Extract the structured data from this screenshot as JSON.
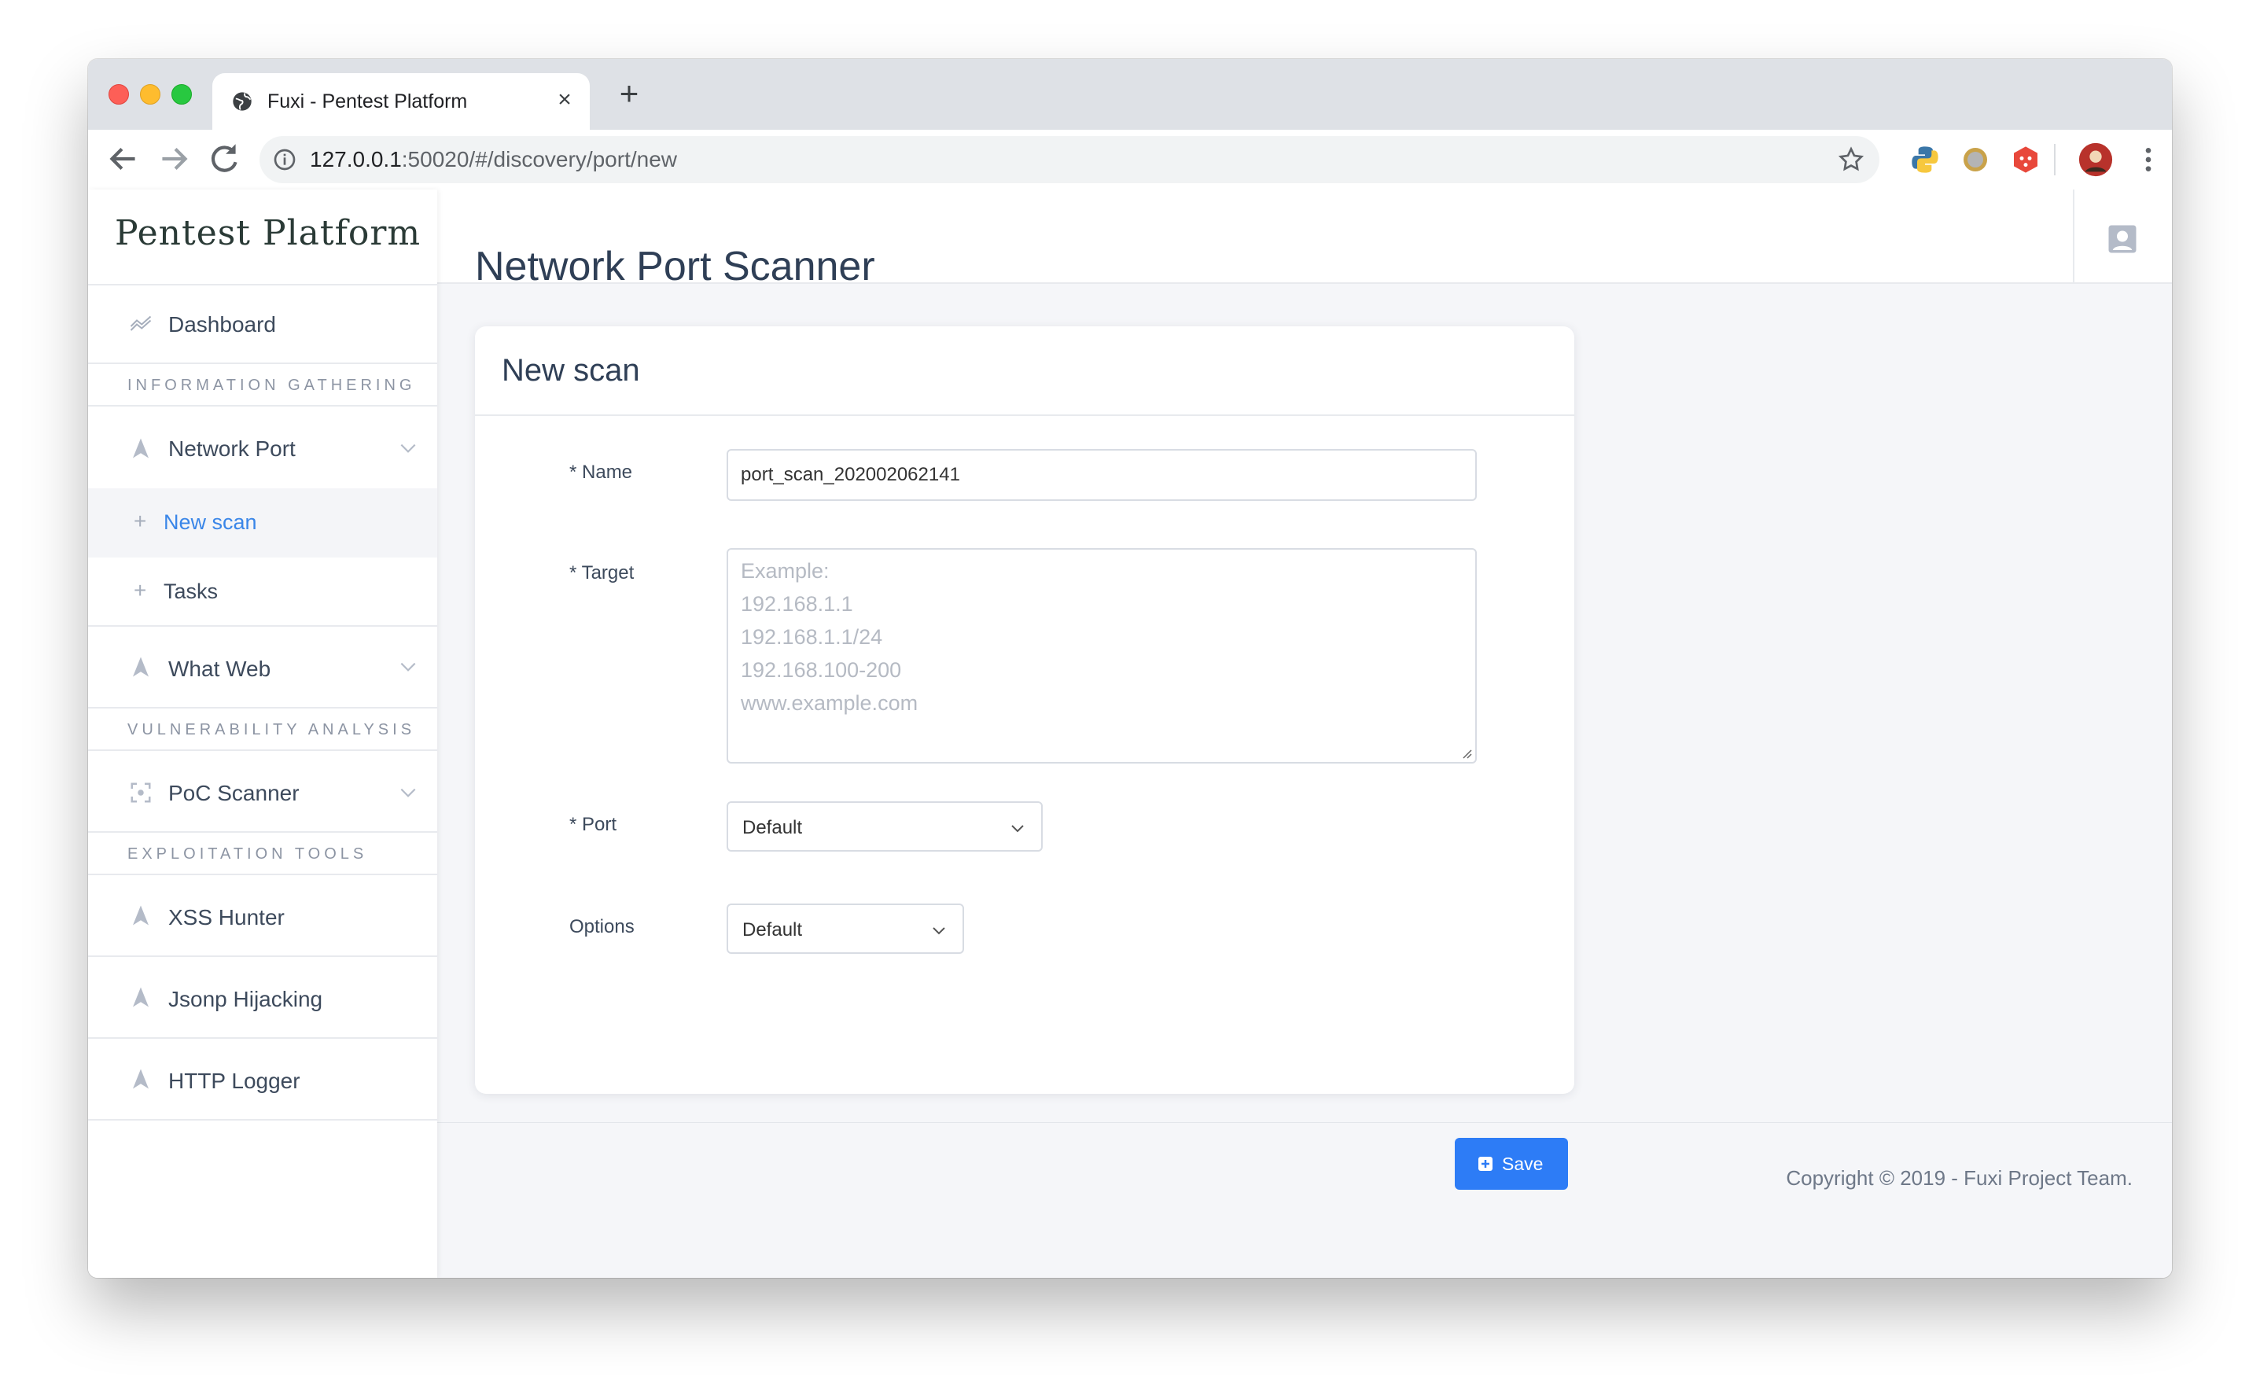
{
  "browser": {
    "tab_title": "Fuxi - Pentest Platform",
    "url_host": "127.0.0.1",
    "url_rest": ":50020/#/discovery/port/new"
  },
  "sidebar": {
    "brand": "Pentest Platform",
    "dashboard": "Dashboard",
    "sections": {
      "info_gathering": "INFORMATION GATHERING",
      "vuln_analysis": "VULNERABILITY ANALYSIS",
      "exploitation": "EXPLOITATION TOOLS"
    },
    "network_port": "Network Port",
    "new_scan": "New scan",
    "tasks": "Tasks",
    "what_web": "What Web",
    "poc_scanner": "PoC Scanner",
    "xss_hunter": "XSS Hunter",
    "jsonp_hijacking": "Jsonp Hijacking",
    "http_logger": "HTTP Logger"
  },
  "main": {
    "page_title": "Network Port Scanner",
    "card_title": "New scan",
    "form": {
      "name_label": "* Name",
      "name_value": "port_scan_202002062141",
      "target_label": "* Target",
      "target_placeholder": [
        "Example:",
        "192.168.1.1",
        "192.168.1.1/24",
        "192.168.100-200",
        "www.example.com"
      ],
      "port_label": "* Port",
      "port_value": "Default",
      "options_label": "Options",
      "options_value": "Default",
      "save_label": "Save"
    }
  },
  "footer": {
    "copyright": "Copyright © 2019 - Fuxi Project Team."
  },
  "colors": {
    "accent": "#2d7cf6",
    "active_text": "#3a86e8"
  }
}
